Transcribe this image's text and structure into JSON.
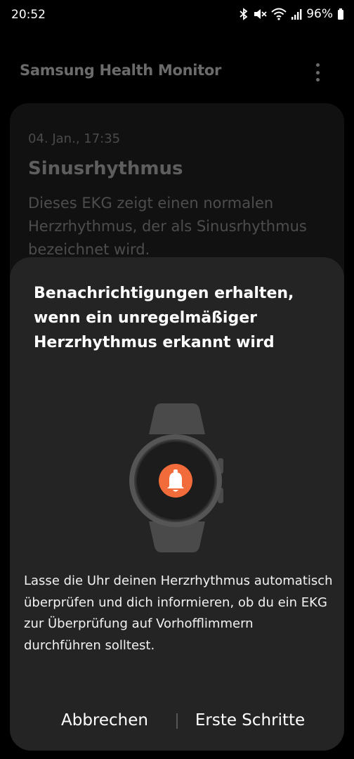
{
  "status_bar": {
    "time": "20:52",
    "battery": "96%",
    "icons": [
      "bluetooth-icon",
      "mute-icon",
      "wifi-icon",
      "signal-icon",
      "battery-icon"
    ]
  },
  "header": {
    "title": "Samsung Health Monitor",
    "more_icon": "more-vertical-icon"
  },
  "ecg_card": {
    "date": "04. Jan., 17:35",
    "title": "Sinusrhythmus",
    "description": "Dieses EKG zeigt einen normalen Herzrhythmus, der als Sinusrhythmus bezeichnet wird."
  },
  "dialog": {
    "title": "Benachrichtigungen erhalten, wenn ein unregelmäßiger Herzrhythmus erkannt wird",
    "illustration_icon": "bell-icon",
    "body": "Lasse die Uhr deinen Herzrhythmus automatisch überprüfen und dich informieren, ob du ein EKG zur Überprüfung auf Vorhofflimmern durchführen solltest.",
    "cancel_label": "Abbrechen",
    "confirm_label": "Erste Schritte"
  },
  "colors": {
    "accent": "#f26b3a",
    "dialog_bg": "#242424",
    "dim_text": "#6b6b6b"
  }
}
